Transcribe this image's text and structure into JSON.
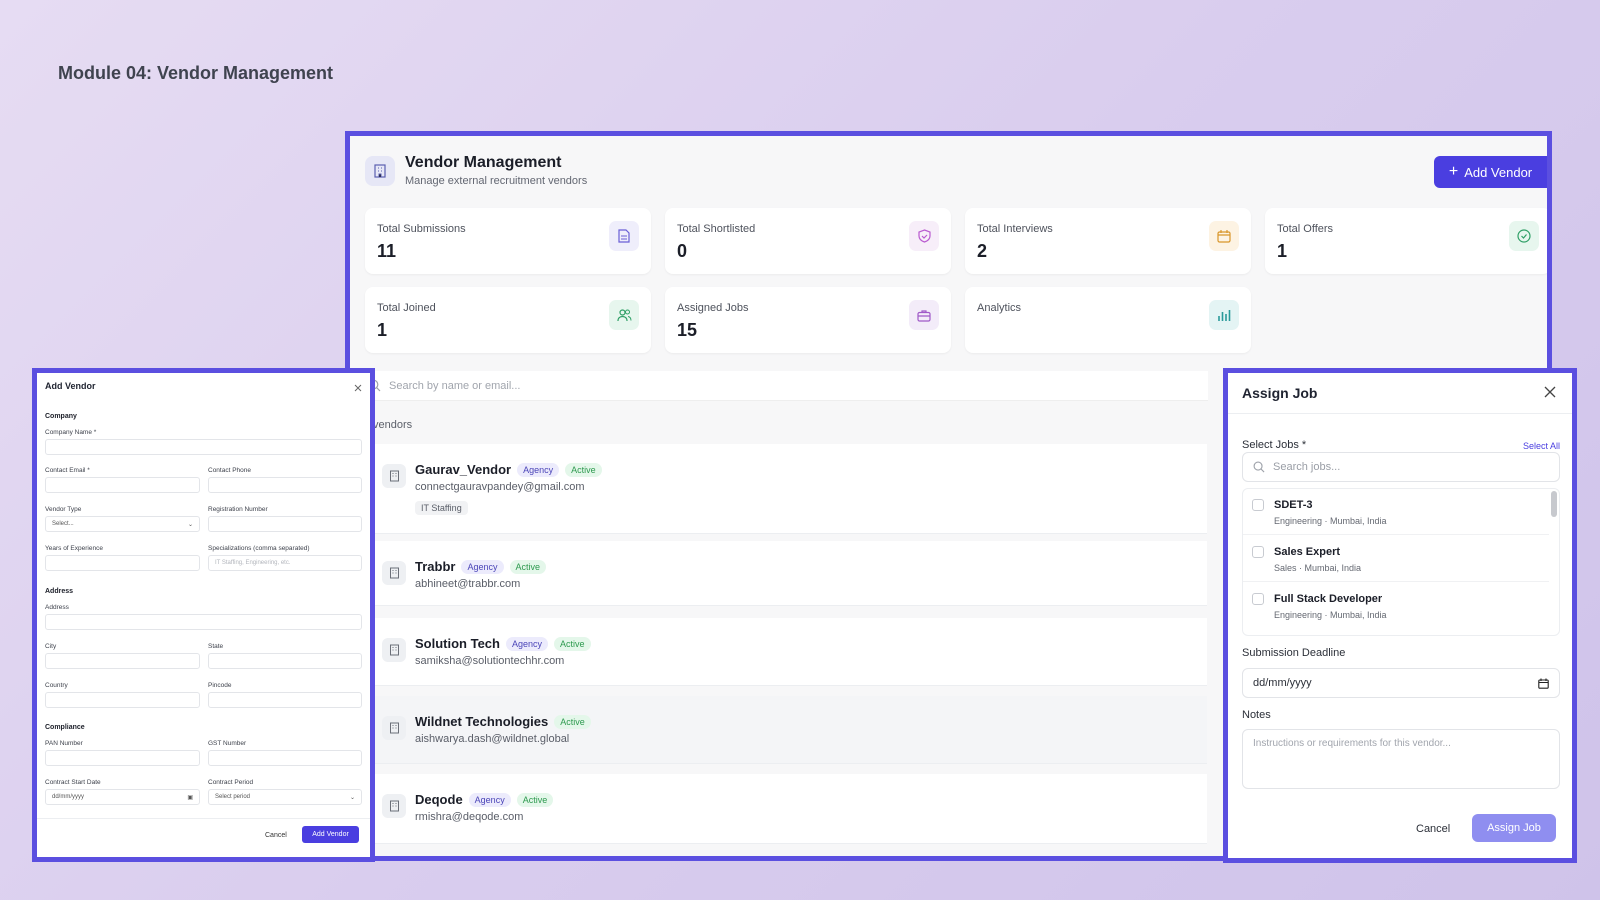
{
  "module_title": "Module 04: Vendor Management",
  "main": {
    "title": "Vendor Management",
    "subtitle": "Manage external recruitment vendors",
    "add_vendor_label": "Add Vendor",
    "cards": [
      {
        "label": "Total Submissions",
        "value": "11",
        "icon": "document-icon",
        "color": "#efeefb"
      },
      {
        "label": "Total Shortlisted",
        "value": "0",
        "icon": "shield-check-icon",
        "color": "#f7eef9"
      },
      {
        "label": "Total Interviews",
        "value": "2",
        "icon": "calendar-icon",
        "color": "#fdf3e3"
      },
      {
        "label": "Total Offers",
        "value": "1",
        "icon": "check-circle-icon",
        "color": "#e7f6ee"
      },
      {
        "label": "Total Joined",
        "value": "1",
        "icon": "users-icon",
        "color": "#e7f6ee"
      },
      {
        "label": "Assigned Jobs",
        "value": "15",
        "icon": "briefcase-icon",
        "color": "#f3ecf9"
      },
      {
        "label": "Analytics",
        "value": "",
        "icon": "bar-chart-icon",
        "color": "#e4f4f4"
      }
    ],
    "search_placeholder": "Search by name or email...",
    "vendors_label": "vendors",
    "vendors": [
      {
        "name": "Gaurav_Vendor",
        "type": "Agency",
        "status": "Active",
        "email": "connectgauravpandey@gmail.com",
        "specialization": "IT Staffing"
      },
      {
        "name": "Trabbr",
        "type": "Agency",
        "status": "Active",
        "email": "abhineet@trabbr.com"
      },
      {
        "name": "Solution Tech",
        "type": "Agency",
        "status": "Active",
        "email": "samiksha@solutiontechhr.com"
      },
      {
        "name": "Wildnet Technologies",
        "status": "Active",
        "email": "aishwarya.dash@wildnet.global"
      },
      {
        "name": "Deqode",
        "type": "Agency",
        "status": "Active",
        "email": "rmishra@deqode.com"
      }
    ]
  },
  "add_vendor_modal": {
    "title": "Add Vendor",
    "section_company": "Company",
    "company_name": "Company Name *",
    "contact_email": "Contact Email *",
    "contact_phone": "Contact Phone",
    "vendor_type": "Vendor Type",
    "vendor_type_value": "Select...",
    "registration_number": "Registration Number",
    "years_experience": "Years of Experience",
    "specializations": "Specializations (comma separated)",
    "specializations_placeholder": "IT Staffing, Engineering, etc.",
    "section_address": "Address",
    "address": "Address",
    "city": "City",
    "state": "State",
    "country": "Country",
    "pincode": "Pincode",
    "section_compliance": "Compliance",
    "pan": "PAN Number",
    "gst": "GST Number",
    "contract_start": "Contract Start Date",
    "contract_start_value": "dd/mm/yyyy",
    "contract_period": "Contract Period",
    "contract_period_value": "Select period",
    "cancel": "Cancel",
    "submit": "Add Vendor"
  },
  "assign_modal": {
    "title": "Assign Job",
    "select_jobs_label": "Select Jobs *",
    "select_all": "Select All",
    "search_placeholder": "Search jobs...",
    "jobs": [
      {
        "title": "SDET-3",
        "meta": "Engineering · Mumbai, India"
      },
      {
        "title": "Sales Expert",
        "meta": "Sales · Mumbai, India"
      },
      {
        "title": "Full Stack Developer",
        "meta": "Engineering · Mumbai, India"
      }
    ],
    "deadline_label": "Submission Deadline",
    "deadline_value": "dd/mm/yyyy",
    "notes_label": "Notes",
    "notes_placeholder": "Instructions or requirements for this vendor...",
    "cancel": "Cancel",
    "submit": "Assign Job"
  },
  "colors": {
    "accent": "#4a3ee0",
    "frame": "#5b4fe0"
  }
}
